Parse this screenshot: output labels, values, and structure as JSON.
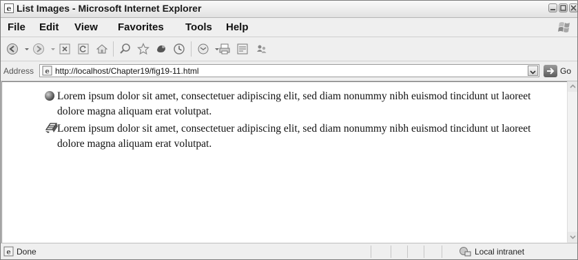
{
  "window": {
    "title": "List Images - Microsoft Internet Explorer"
  },
  "menu": {
    "items": [
      "File",
      "Edit",
      "View",
      "Favorites",
      "Tools",
      "Help"
    ]
  },
  "address": {
    "label": "Address",
    "url": "http://localhost/Chapter19/fig19-11.html",
    "go_label": "Go"
  },
  "content": {
    "items": [
      {
        "text": "Lorem ipsum dolor sit amet, consectetuer adipiscing elit, sed diam nonummy nibh euismod tincidunt ut laoreet dolore magna aliquam erat volutpat.",
        "bullet_icon": "circle-bullet-icon"
      },
      {
        "text": "Lorem ipsum dolor sit amet, consectetuer adipiscing elit, sed diam nonummy nibh euismod tincidunt ut laoreet dolore magna aliquam erat volutpat.",
        "bullet_icon": "image-bullet-icon"
      }
    ]
  },
  "status": {
    "text": "Done",
    "zone": "Local intranet"
  },
  "toolbar": {
    "icons": [
      "back-icon",
      "forward-icon",
      "stop-icon",
      "refresh-icon",
      "home-icon",
      "search-icon",
      "favorites-icon",
      "media-icon",
      "history-icon",
      "mail-icon",
      "print-icon",
      "edit-icon",
      "messenger-icon"
    ]
  }
}
